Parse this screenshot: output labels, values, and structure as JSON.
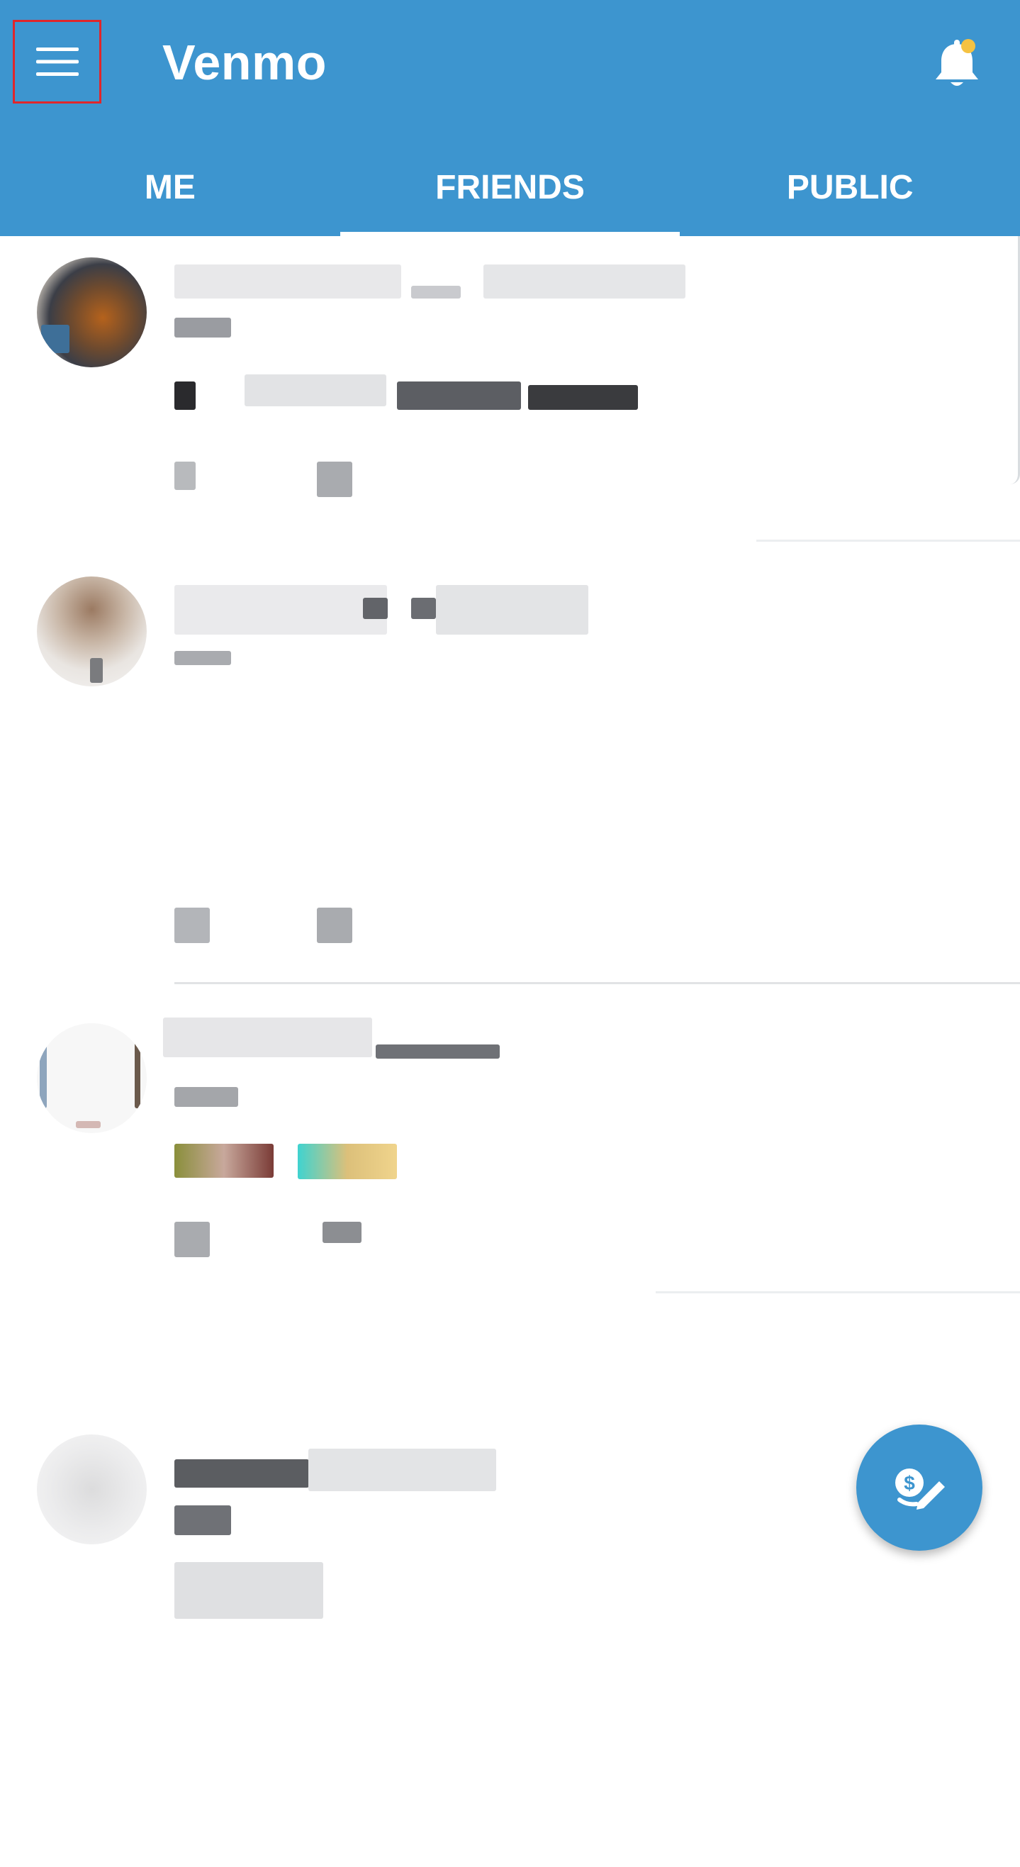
{
  "app": {
    "title": "Venmo"
  },
  "header": {
    "menu_icon": "hamburger-menu-icon",
    "notification_icon": "bell-icon",
    "notification_dot_color": "#f5c242"
  },
  "tabs": [
    {
      "label": "ME"
    },
    {
      "label": "FRIENDS"
    },
    {
      "label": "PUBLIC"
    }
  ],
  "active_tab": "FRIENDS",
  "fab": {
    "icon": "pay-or-request-icon"
  },
  "colors": {
    "brand_blue": "#3d95cf",
    "highlight_box": "#e0262b"
  }
}
